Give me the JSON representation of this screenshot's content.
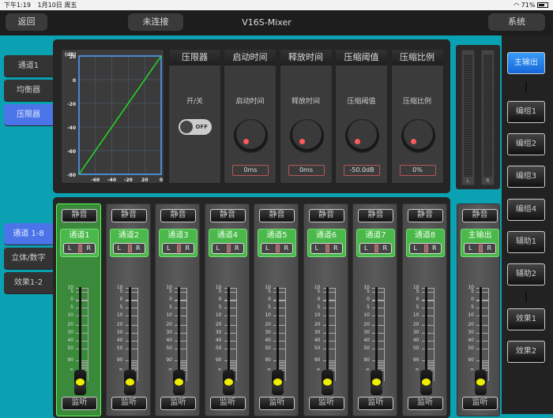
{
  "status": {
    "time": "下午1:19",
    "date": "1月10日 周五",
    "battery": "71%",
    "battery_level": 0.71
  },
  "nav": {
    "back": "返回",
    "connection": "未连接",
    "title": "V16S-Mixer",
    "system": "系统"
  },
  "tabs_top": [
    {
      "label": "通道1",
      "active": false
    },
    {
      "label": "均衡器",
      "active": false
    },
    {
      "label": "压限器",
      "active": true
    }
  ],
  "tabs_bottom": [
    {
      "label": "通道 1-8",
      "active": true
    },
    {
      "label": "立体/数字",
      "active": false
    },
    {
      "label": "效果1-2",
      "active": false
    }
  ],
  "limiter": {
    "graph": {
      "unit": "(dB)",
      "y_ticks": [
        "20",
        "0",
        "-20",
        "-40",
        "-60",
        "-80"
      ],
      "x_ticks": [
        "-60",
        "-40",
        "-20",
        "20",
        "0"
      ],
      "line_color": "#22dd22"
    },
    "enable": {
      "title": "压限器",
      "label": "开/关",
      "state": "OFF"
    },
    "params": [
      {
        "title": "启动时间",
        "label": "启动时间",
        "value": "0ms"
      },
      {
        "title": "释放时间",
        "label": "释放时间",
        "value": "0ms"
      },
      {
        "title": "压缩阈值",
        "label": "压缩阈值",
        "value": "-50.0dB"
      },
      {
        "title": "压缩比例",
        "label": "压缩比例",
        "value": "0%"
      }
    ]
  },
  "strip_labels": {
    "mute": "静音",
    "monitor": "监听",
    "L": "L",
    "R": "R"
  },
  "fader_scale": [
    "10",
    "5",
    "0",
    "5",
    "10",
    "20",
    "30",
    "40",
    "50",
    "90",
    "∞"
  ],
  "channels": [
    {
      "name": "通道1",
      "selected": true
    },
    {
      "name": "通道2"
    },
    {
      "name": "通道3"
    },
    {
      "name": "通道4"
    },
    {
      "name": "通道5"
    },
    {
      "name": "通道6"
    },
    {
      "name": "通道7"
    },
    {
      "name": "通道8"
    }
  ],
  "main_strip": {
    "name": "主输出"
  },
  "meters": {
    "left": "L",
    "right": "R"
  },
  "buses": [
    {
      "label": "主输出",
      "active": true
    },
    {
      "label": "编组1"
    },
    {
      "label": "编组2"
    },
    {
      "label": "编组3"
    },
    {
      "label": "编组4"
    },
    {
      "label": "辅助1"
    },
    {
      "label": "辅助2"
    },
    {
      "label": "效果1"
    },
    {
      "label": "效果2"
    }
  ],
  "colors": {
    "accent_blue": "#4a74e8",
    "selected_green": "#3b8a3b",
    "background": "#0aa2b2"
  }
}
